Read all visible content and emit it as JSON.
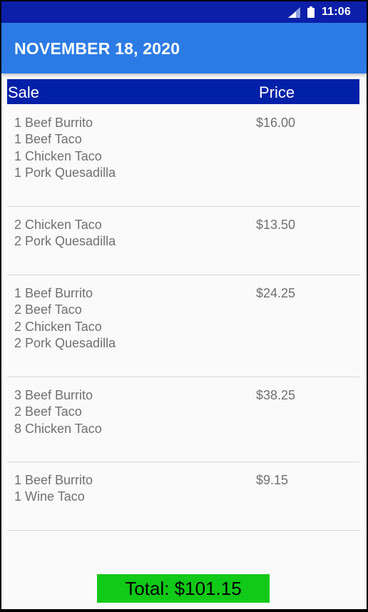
{
  "status_bar": {
    "time": "11:06",
    "signal_icon": "signal-icon",
    "battery_icon": "battery-icon"
  },
  "app_bar": {
    "title": "NOVEMBER 18, 2020"
  },
  "table": {
    "headers": {
      "sale": "Sale",
      "price": "Price"
    },
    "rows": [
      {
        "items": [
          "1 Beef Burrito",
          "1 Beef Taco",
          "1 Chicken Taco",
          "1 Pork Quesadilla"
        ],
        "price": "$16.00"
      },
      {
        "items": [
          "2 Chicken Taco",
          "2 Pork Quesadilla"
        ],
        "price": "$13.50"
      },
      {
        "items": [
          "1 Beef Burrito",
          "2 Beef Taco",
          "2 Chicken Taco",
          "2 Pork Quesadilla"
        ],
        "price": "$24.25"
      },
      {
        "items": [
          "3 Beef Burrito",
          "2 Beef Taco",
          "8 Chicken Taco"
        ],
        "price": "$38.25"
      },
      {
        "items": [
          "1 Beef Burrito",
          "1 Wine Taco"
        ],
        "price": "$9.15"
      }
    ]
  },
  "total": {
    "label": "Total: $101.15"
  },
  "colors": {
    "status_bar": "#0b1fa8",
    "app_bar": "#2c7be5",
    "table_header": "#0020a8",
    "total_bg": "#11c917"
  }
}
